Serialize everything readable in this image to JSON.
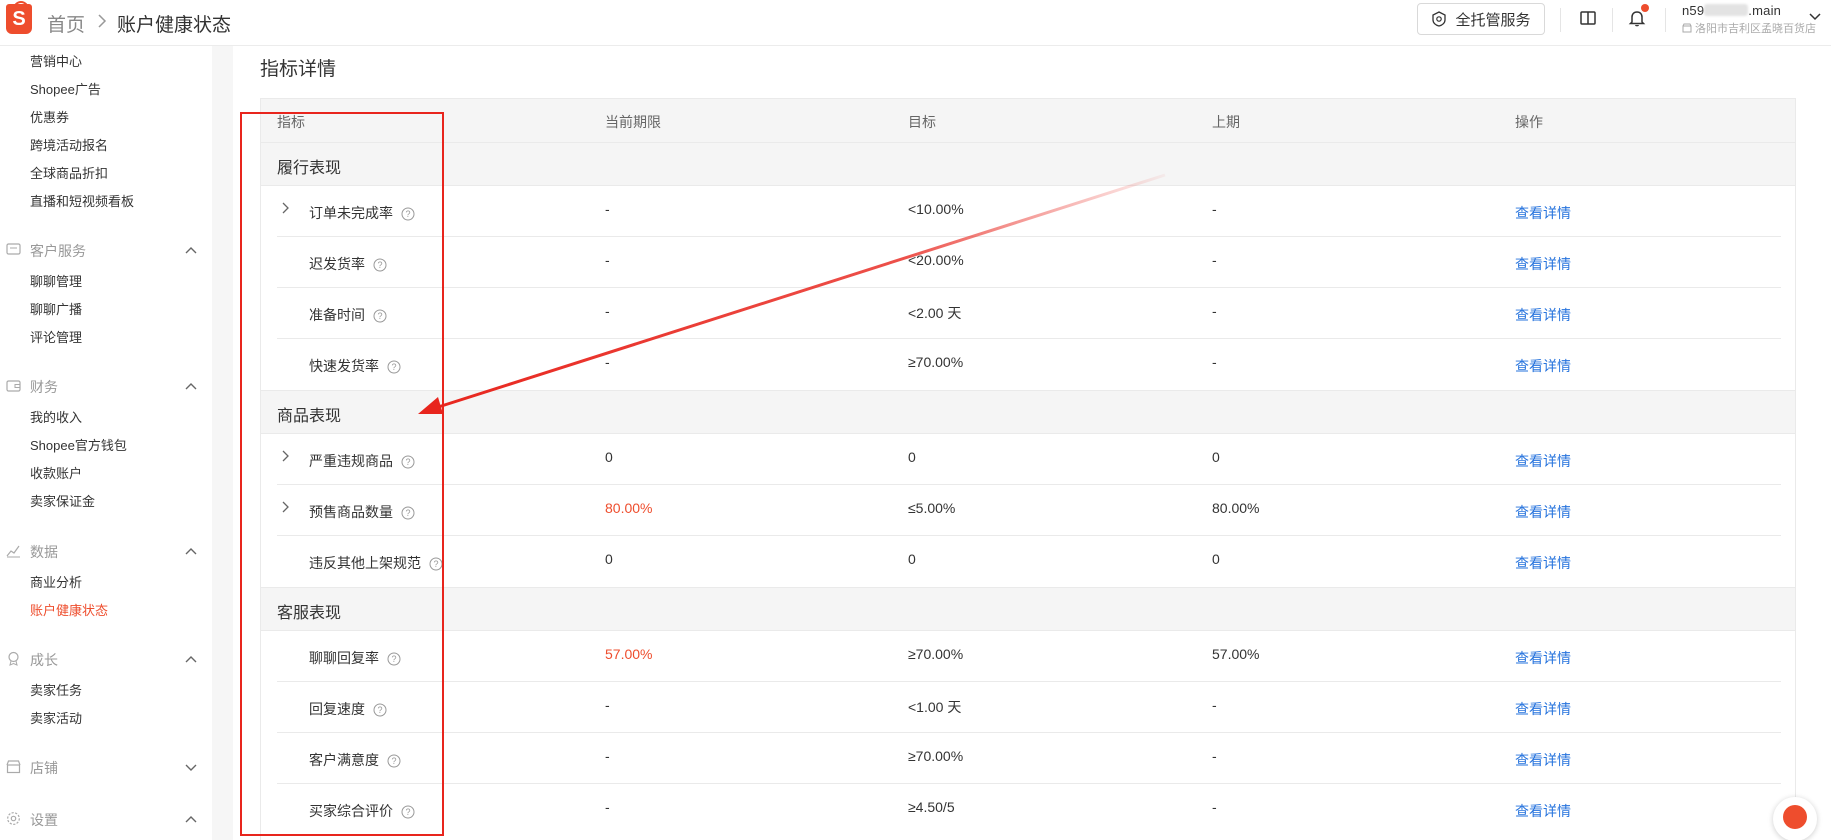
{
  "header": {
    "logo_letter": "S",
    "breadcrumb_home": "首页",
    "breadcrumb_current": "账户健康状态",
    "service_button": "全托管服务",
    "account_name_prefix": "n59",
    "account_name_suffix": ".main",
    "shop_name": "洛阳市吉利区孟晓百货店"
  },
  "sidebar": {
    "marketing_items": [
      "营销中心",
      "Shopee广告",
      "优惠券",
      "跨境活动报名",
      "全球商品折扣",
      "直播和短视频看板"
    ],
    "groups": [
      {
        "label": "客户服务",
        "items": [
          "聊聊管理",
          "聊聊广播",
          "评论管理"
        ]
      },
      {
        "label": "财务",
        "items": [
          "我的收入",
          "Shopee官方钱包",
          "收款账户",
          "卖家保证金"
        ]
      },
      {
        "label": "数据",
        "items": [
          "商业分析",
          "账户健康状态"
        ]
      },
      {
        "label": "成长",
        "items": [
          "卖家任务",
          "卖家活动"
        ]
      },
      {
        "label": "店铺",
        "items": []
      },
      {
        "label": "设置",
        "items": []
      }
    ],
    "active_item": "账户健康状态"
  },
  "main": {
    "title": "指标详情",
    "columns": [
      "指标",
      "当前期限",
      "目标",
      "上期",
      "操作"
    ],
    "sections": [
      {
        "label": "履行表现",
        "rows": [
          {
            "name": "订单未完成率",
            "current": "-",
            "target": "<10.00%",
            "prev": "-",
            "action": "查看详情"
          },
          {
            "name": "迟发货率",
            "current": "-",
            "target": "<20.00%",
            "prev": "-",
            "action": "查看详情"
          },
          {
            "name": "准备时间",
            "current": "-",
            "target": "<2.00 天",
            "prev": "-",
            "action": "查看详情"
          },
          {
            "name": "快速发货率",
            "current": "-",
            "target": "≥70.00%",
            "prev": "-",
            "action": "查看详情"
          }
        ]
      },
      {
        "label": "商品表现",
        "rows": [
          {
            "name": "严重违规商品",
            "current": "0",
            "target": "0",
            "prev": "0",
            "action": "查看详情"
          },
          {
            "name": "预售商品数量",
            "current": "80.00%",
            "target": "≤5.00%",
            "prev": "80.00%",
            "action": "查看详情"
          },
          {
            "name": "违反其他上架规范",
            "current": "0",
            "target": "0",
            "prev": "0",
            "action": "查看详情"
          }
        ]
      },
      {
        "label": "客服表现",
        "rows": [
          {
            "name": "聊聊回复率",
            "current": "57.00%",
            "target": "≥70.00%",
            "prev": "57.00%",
            "action": "查看详情"
          },
          {
            "name": "回复速度",
            "current": "-",
            "target": "<1.00 天",
            "prev": "-",
            "action": "查看详情"
          },
          {
            "name": "客户满意度",
            "current": "-",
            "target": "≥70.00%",
            "prev": "-",
            "action": "查看详情"
          },
          {
            "name": "买家综合评价",
            "current": "-",
            "target": "≥4.50/5",
            "prev": "-",
            "action": "查看详情"
          }
        ]
      }
    ]
  },
  "colors": {
    "brand": "#ee4d2d",
    "link": "#2673dd",
    "annotation": "#e8251d"
  }
}
